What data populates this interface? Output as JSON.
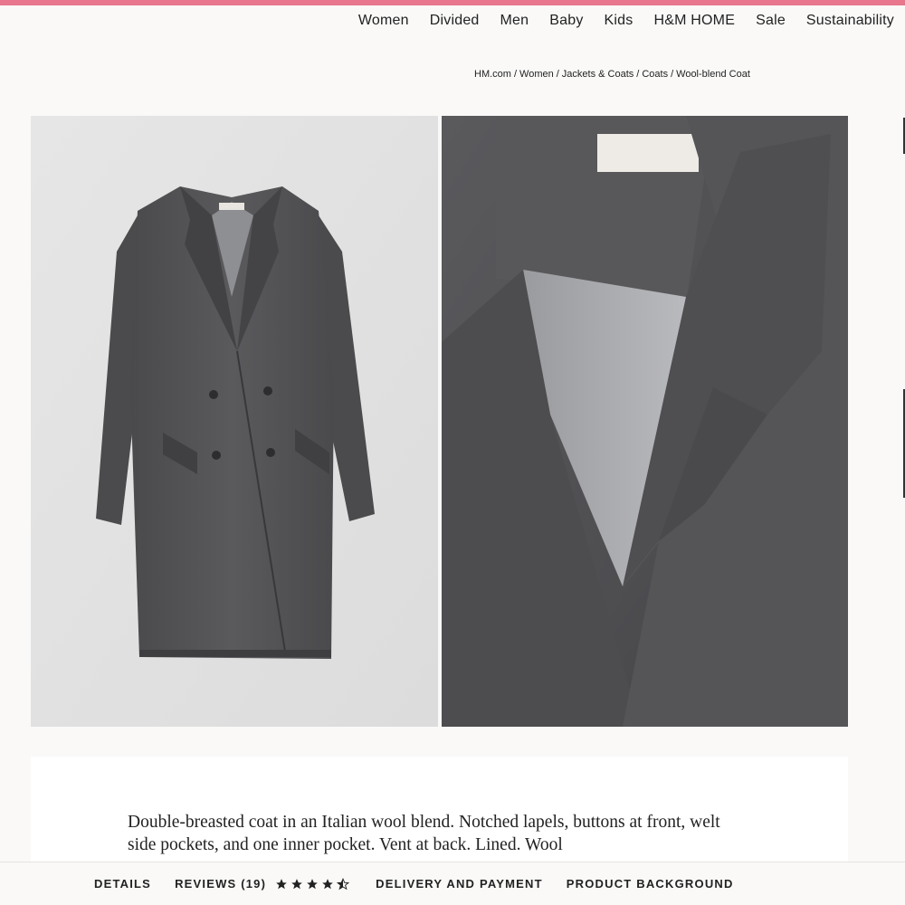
{
  "colors": {
    "accent_bar": "#e8768c"
  },
  "nav": {
    "items": [
      {
        "label": "Women"
      },
      {
        "label": "Divided"
      },
      {
        "label": "Men"
      },
      {
        "label": "Baby"
      },
      {
        "label": "Kids"
      },
      {
        "label": "H&M HOME"
      },
      {
        "label": "Sale"
      },
      {
        "label": "Sustainability"
      }
    ]
  },
  "breadcrumb": {
    "items": [
      "HM.com",
      "Women",
      "Jackets & Coats",
      "Coats",
      "Wool-blend Coat"
    ],
    "separator": "/"
  },
  "product": {
    "description": "Double-breasted coat in an Italian wool blend. Notched lapels, buttons at front, welt side pockets, and one inner pocket. Vent at back. Lined. Wool"
  },
  "tabs": {
    "details": "DETAILS",
    "reviews": "REVIEWS (19)",
    "rating": 4.5,
    "delivery": "DELIVERY AND PAYMENT",
    "background": "PRODUCT BACKGROUND"
  }
}
